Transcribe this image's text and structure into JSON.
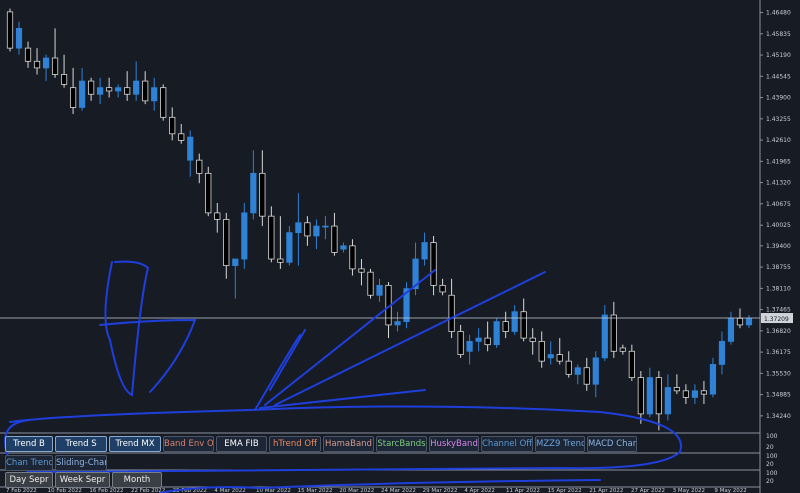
{
  "price_axis": {
    "labels": [
      "1.46480",
      "1.45835",
      "1.45190",
      "1.44545",
      "1.43900",
      "1.43255",
      "1.42610",
      "1.41965",
      "1.41320",
      "1.40675",
      "1.40025",
      "1.39400",
      "1.38755",
      "1.38110",
      "1.37465",
      "1.36820",
      "1.36175",
      "1.35530",
      "1.34885",
      "1.34240"
    ],
    "current_price": "1.37209",
    "indicator_scale_1": [
      "100",
      "20"
    ],
    "indicator_scale_2": [
      "100",
      "20"
    ],
    "indicator_scale_3": [
      "100",
      "20"
    ]
  },
  "date_axis": {
    "labels": [
      "7 Feb 2022",
      "10 Feb 2022",
      "16 Feb 2022",
      "22 Feb 2022",
      "25 Feb 2022",
      "4 Mar 2022",
      "10 Mar 2022",
      "15 Mar 2022",
      "20 Mar 2022",
      "24 Mar 2022",
      "29 Mar 2022",
      "4 Apr 2022",
      "11 Apr 2022",
      "15 Apr 2022",
      "21 Apr 2022",
      "27 Apr 2022",
      "3 May 2022",
      "9 May 2022"
    ]
  },
  "toolbar_row1": [
    {
      "label": "Trend B",
      "color": "#ffffff"
    },
    {
      "label": "Trend S",
      "color": "#ffffff"
    },
    {
      "label": "Trend MX",
      "color": "#ffffff"
    },
    {
      "label": "Band Env Off",
      "color": "#d9826b"
    },
    {
      "label": "EMA FIB",
      "color": "#ffffff"
    },
    {
      "label": "hTrend Off",
      "color": "#f08a5a"
    },
    {
      "label": "HamaBand",
      "color": "#d49b8a"
    },
    {
      "label": "StarcBands",
      "color": "#7fcf7a"
    },
    {
      "label": "HuskyBand",
      "color": "#d884e8"
    },
    {
      "label": "Channel Off",
      "color": "#5b9bd6"
    },
    {
      "label": "MZZ9 Trend",
      "color": "#6fa6e0"
    },
    {
      "label": "MACD Chart",
      "color": "#8fb4e0"
    }
  ],
  "toolbar_row2": [
    {
      "label": "Chan Trend",
      "color": "#5b9bd6"
    },
    {
      "label": "Sliding-Chan",
      "color": "#8fb4e0"
    }
  ],
  "toolbar_row3": [
    {
      "label": "Day Sepr",
      "color": "#eeeeee"
    },
    {
      "label": "Week Sepr",
      "color": "#eeeeee"
    },
    {
      "label": "Month",
      "color": "#eeeeee"
    }
  ],
  "chart_data": {
    "type": "candlestick",
    "symbol_hint": "",
    "y_range": [
      1.3375,
      1.468
    ],
    "current_price": 1.37209,
    "candles": [
      [
        1.465,
        1.466,
        1.453,
        1.454
      ],
      [
        1.454,
        1.462,
        1.452,
        1.46
      ],
      [
        1.454,
        1.456,
        1.448,
        1.45
      ],
      [
        1.45,
        1.454,
        1.446,
        1.448
      ],
      [
        1.448,
        1.452,
        1.444,
        1.451
      ],
      [
        1.451,
        1.46,
        1.445,
        1.446
      ],
      [
        1.446,
        1.452,
        1.442,
        1.443
      ],
      [
        1.442,
        1.448,
        1.434,
        1.436
      ],
      [
        1.436,
        1.448,
        1.435,
        1.444
      ],
      [
        1.444,
        1.445,
        1.438,
        1.44
      ],
      [
        1.44,
        1.445,
        1.437,
        1.442
      ],
      [
        1.442,
        1.445,
        1.439,
        1.441
      ],
      [
        1.441,
        1.443,
        1.439,
        1.442
      ],
      [
        1.442,
        1.447,
        1.438,
        1.44
      ],
      [
        1.44,
        1.45,
        1.438,
        1.444
      ],
      [
        1.444,
        1.447,
        1.437,
        1.438
      ],
      [
        1.438,
        1.445,
        1.435,
        1.442
      ],
      [
        1.442,
        1.443,
        1.432,
        1.433
      ],
      [
        1.433,
        1.436,
        1.426,
        1.428
      ],
      [
        1.428,
        1.431,
        1.425,
        1.426
      ],
      [
        1.42,
        1.429,
        1.415,
        1.427
      ],
      [
        1.42,
        1.422,
        1.413,
        1.416
      ],
      [
        1.416,
        1.418,
        1.403,
        1.404
      ],
      [
        1.404,
        1.407,
        1.398,
        1.402
      ],
      [
        1.402,
        1.404,
        1.384,
        1.388
      ],
      [
        1.388,
        1.39,
        1.378,
        1.39
      ],
      [
        1.39,
        1.407,
        1.387,
        1.404
      ],
      [
        1.404,
        1.423,
        1.402,
        1.416
      ],
      [
        1.416,
        1.423,
        1.4,
        1.403
      ],
      [
        1.403,
        1.406,
        1.389,
        1.39
      ],
      [
        1.39,
        1.403,
        1.387,
        1.389
      ],
      [
        1.389,
        1.4,
        1.388,
        1.398
      ],
      [
        1.398,
        1.41,
        1.388,
        1.401
      ],
      [
        1.401,
        1.403,
        1.394,
        1.397
      ],
      [
        1.397,
        1.402,
        1.393,
        1.4
      ],
      [
        1.4,
        1.403,
        1.396,
        1.4
      ],
      [
        1.4,
        1.404,
        1.391,
        1.392
      ],
      [
        1.393,
        1.395,
        1.392,
        1.394
      ],
      [
        1.394,
        1.396,
        1.385,
        1.387
      ],
      [
        1.387,
        1.39,
        1.382,
        1.386
      ],
      [
        1.386,
        1.387,
        1.378,
        1.379
      ],
      [
        1.379,
        1.384,
        1.377,
        1.382
      ],
      [
        1.382,
        1.383,
        1.366,
        1.37
      ],
      [
        1.37,
        1.374,
        1.368,
        1.371
      ],
      [
        1.371,
        1.383,
        1.369,
        1.381
      ],
      [
        1.381,
        1.395,
        1.379,
        1.39
      ],
      [
        1.39,
        1.398,
        1.388,
        1.395
      ],
      [
        1.395,
        1.397,
        1.379,
        1.382
      ],
      [
        1.382,
        1.384,
        1.379,
        1.38
      ],
      [
        1.379,
        1.384,
        1.366,
        1.368
      ],
      [
        1.368,
        1.37,
        1.36,
        1.361
      ],
      [
        1.362,
        1.367,
        1.358,
        1.365
      ],
      [
        1.365,
        1.369,
        1.362,
        1.366
      ],
      [
        1.366,
        1.371,
        1.362,
        1.364
      ],
      [
        1.364,
        1.372,
        1.363,
        1.371
      ],
      [
        1.371,
        1.374,
        1.366,
        1.368
      ],
      [
        1.368,
        1.376,
        1.367,
        1.374
      ],
      [
        1.374,
        1.378,
        1.365,
        1.366
      ],
      [
        1.366,
        1.369,
        1.361,
        1.365
      ],
      [
        1.365,
        1.368,
        1.357,
        1.359
      ],
      [
        1.36,
        1.365,
        1.358,
        1.361
      ],
      [
        1.361,
        1.366,
        1.358,
        1.359
      ],
      [
        1.359,
        1.362,
        1.354,
        1.355
      ],
      [
        1.355,
        1.358,
        1.352,
        1.357
      ],
      [
        1.357,
        1.36,
        1.35,
        1.352
      ],
      [
        1.352,
        1.362,
        1.348,
        1.36
      ],
      [
        1.36,
        1.376,
        1.359,
        1.373
      ],
      [
        1.373,
        1.377,
        1.36,
        1.362
      ],
      [
        1.363,
        1.364,
        1.361,
        1.362
      ],
      [
        1.362,
        1.364,
        1.353,
        1.354
      ],
      [
        1.354,
        1.356,
        1.34,
        1.343
      ],
      [
        1.343,
        1.357,
        1.342,
        1.354
      ],
      [
        1.354,
        1.356,
        1.338,
        1.343
      ],
      [
        1.343,
        1.355,
        1.341,
        1.351
      ],
      [
        1.351,
        1.355,
        1.349,
        1.35
      ],
      [
        1.35,
        1.352,
        1.346,
        1.348
      ],
      [
        1.348,
        1.352,
        1.346,
        1.35
      ],
      [
        1.35,
        1.353,
        1.346,
        1.349
      ],
      [
        1.349,
        1.36,
        1.348,
        1.358
      ],
      [
        1.358,
        1.368,
        1.355,
        1.365
      ],
      [
        1.365,
        1.374,
        1.364,
        1.372
      ],
      [
        1.372,
        1.375,
        1.369,
        1.37
      ],
      [
        1.37,
        1.373,
        1.369,
        1.372
      ]
    ]
  }
}
